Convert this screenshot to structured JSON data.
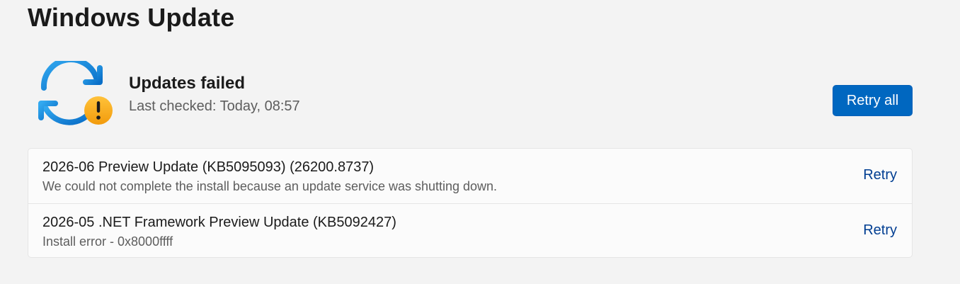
{
  "page": {
    "title": "Windows Update"
  },
  "status": {
    "icon": "sync-warning-icon",
    "title": "Updates failed",
    "last_checked": "Last checked: Today, 08:57",
    "retry_all_label": "Retry all"
  },
  "updates": [
    {
      "name": "2026-06 Preview Update (KB5095093) (26200.8737)",
      "detail": "We could not complete the install because an update service was shutting down.",
      "action_label": "Retry"
    },
    {
      "name": "2026-05 .NET Framework Preview Update (KB5092427)",
      "detail": "Install error - 0x8000ffff",
      "action_label": "Retry"
    }
  ],
  "colors": {
    "accent": "#0067c0",
    "link": "#003e92",
    "sync_icon_blue": "#1a8fe0",
    "warning_badge": "#f5a318",
    "background": "#f3f3f3",
    "card": "#fbfbfb"
  }
}
